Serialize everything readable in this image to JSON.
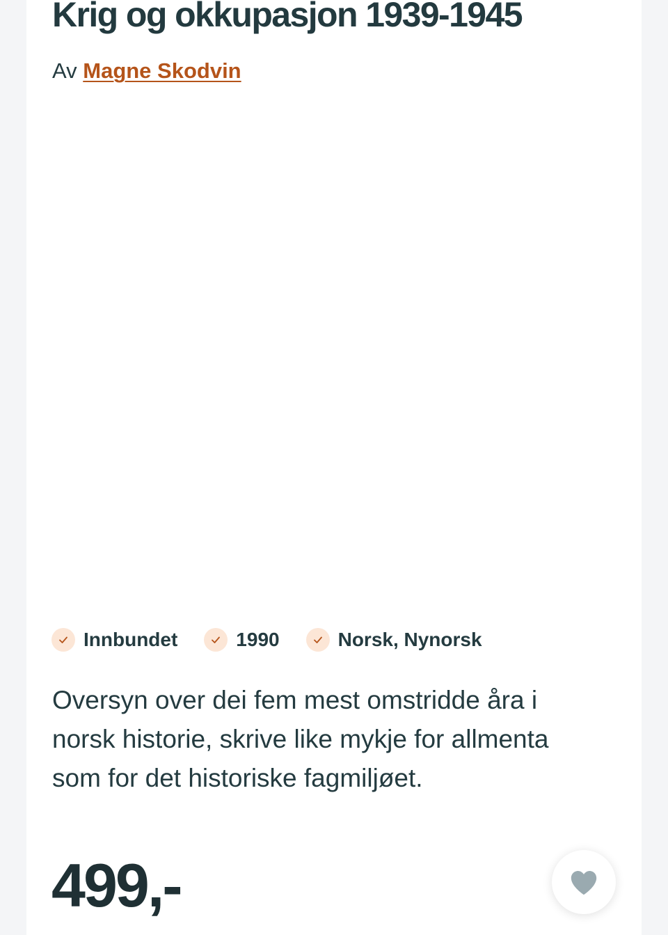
{
  "product": {
    "title": "Krig og okkupasjon 1939-1945",
    "byline_prefix": "Av",
    "author": "Magne Skodvin",
    "features": [
      {
        "icon": "check-icon",
        "label": "Innbundet"
      },
      {
        "icon": "check-icon",
        "label": "1990"
      },
      {
        "icon": "check-icon",
        "label": "Norsk, Nynorsk"
      }
    ],
    "description": "Oversyn over dei fem mest omstridde åra i norsk historie, skrive like mykje for allmenta som for det historiske fagmiljøet.",
    "price": "499,-"
  },
  "wishlist": {
    "icon": "heart-icon"
  },
  "colors": {
    "accent": "#b5541a",
    "text": "#243b40",
    "check_bg": "#fce6d6",
    "heart": "#9aaab0",
    "page_bg": "#f4f5f7"
  }
}
